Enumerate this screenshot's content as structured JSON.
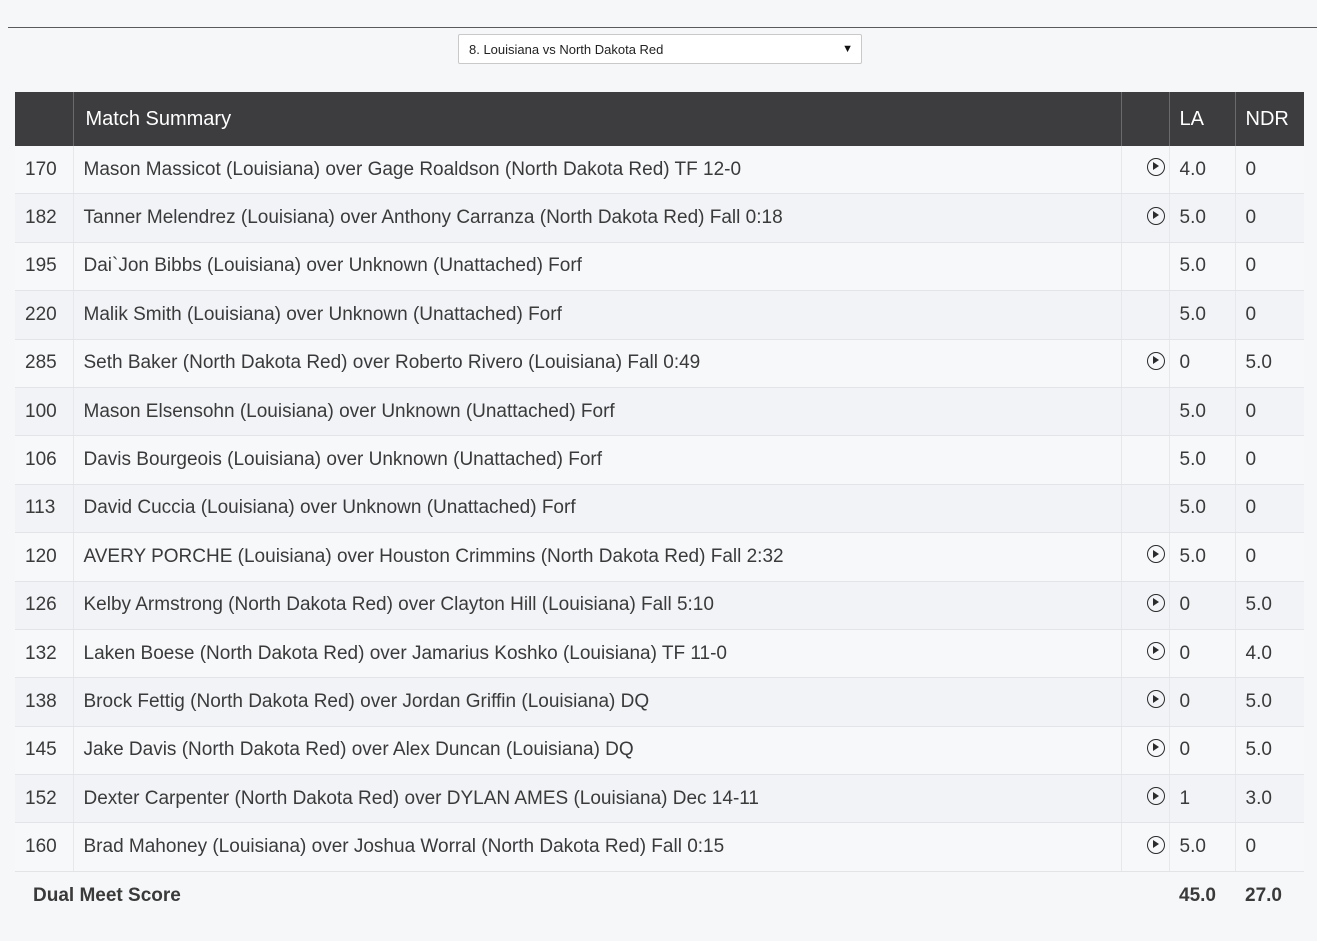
{
  "selector": {
    "selected": "8. Louisiana vs North Dakota Red"
  },
  "table": {
    "headers": {
      "summary": "Match Summary",
      "team_a": "LA",
      "team_b": "NDR"
    },
    "rows": [
      {
        "weight": "170",
        "desc": "Mason Massicot (Louisiana) over Gage Roaldson (North Dakota Red) TF 12-0",
        "video": true,
        "la": "4.0",
        "ndr": "0"
      },
      {
        "weight": "182",
        "desc": "Tanner Melendrez (Louisiana) over Anthony Carranza (North Dakota Red) Fall 0:18",
        "video": true,
        "la": "5.0",
        "ndr": "0"
      },
      {
        "weight": "195",
        "desc": "Dai`Jon Bibbs (Louisiana) over Unknown (Unattached) Forf",
        "video": false,
        "la": "5.0",
        "ndr": "0"
      },
      {
        "weight": "220",
        "desc": "Malik Smith (Louisiana) over Unknown (Unattached) Forf",
        "video": false,
        "la": "5.0",
        "ndr": "0"
      },
      {
        "weight": "285",
        "desc": "Seth Baker (North Dakota Red) over Roberto Rivero (Louisiana) Fall 0:49",
        "video": true,
        "la": "0",
        "ndr": "5.0"
      },
      {
        "weight": "100",
        "desc": "Mason Elsensohn (Louisiana) over Unknown (Unattached) Forf",
        "video": false,
        "la": "5.0",
        "ndr": "0"
      },
      {
        "weight": "106",
        "desc": "Davis Bourgeois (Louisiana) over Unknown (Unattached) Forf",
        "video": false,
        "la": "5.0",
        "ndr": "0"
      },
      {
        "weight": "113",
        "desc": "David Cuccia (Louisiana) over Unknown (Unattached) Forf",
        "video": false,
        "la": "5.0",
        "ndr": "0"
      },
      {
        "weight": "120",
        "desc": "AVERY PORCHE (Louisiana) over Houston Crimmins (North Dakota Red) Fall 2:32",
        "video": true,
        "la": "5.0",
        "ndr": "0"
      },
      {
        "weight": "126",
        "desc": "Kelby Armstrong (North Dakota Red) over Clayton Hill (Louisiana) Fall 5:10",
        "video": true,
        "la": "0",
        "ndr": "5.0"
      },
      {
        "weight": "132",
        "desc": "Laken Boese (North Dakota Red) over Jamarius Koshko (Louisiana) TF 11-0",
        "video": true,
        "la": "0",
        "ndr": "4.0"
      },
      {
        "weight": "138",
        "desc": "Brock Fettig (North Dakota Red) over Jordan Griffin (Louisiana) DQ",
        "video": true,
        "la": "0",
        "ndr": "5.0"
      },
      {
        "weight": "145",
        "desc": "Jake Davis (North Dakota Red) over Alex Duncan (Louisiana) DQ",
        "video": true,
        "la": "0",
        "ndr": "5.0"
      },
      {
        "weight": "152",
        "desc": "Dexter Carpenter (North Dakota Red) over DYLAN AMES (Louisiana) Dec 14-11",
        "video": true,
        "la": "1",
        "ndr": "3.0"
      },
      {
        "weight": "160",
        "desc": "Brad Mahoney (Louisiana) over Joshua Worral (North Dakota Red) Fall 0:15",
        "video": true,
        "la": "5.0",
        "ndr": "0"
      }
    ],
    "footer": {
      "label": "Dual Meet Score",
      "la_total": "45.0",
      "ndr_total": "27.0"
    }
  },
  "icons": {
    "video": "play-circle-icon",
    "dropdown": "caret-down-icon"
  }
}
